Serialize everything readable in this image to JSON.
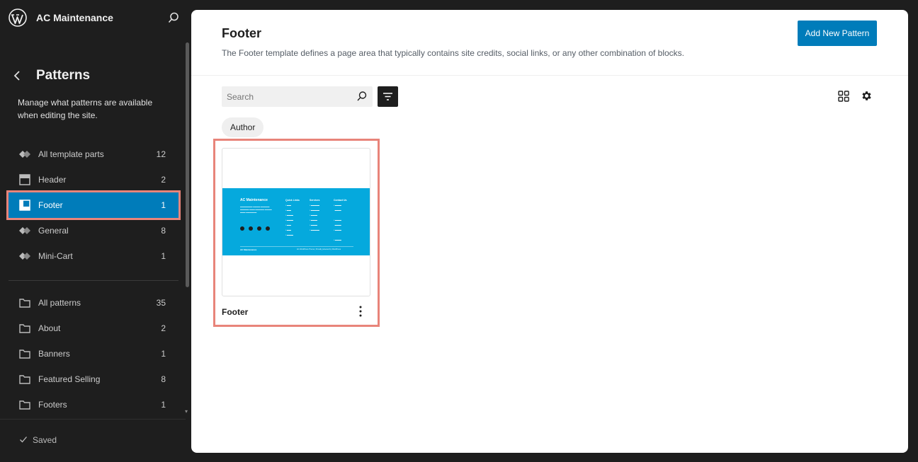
{
  "site": {
    "name": "AC Maintenance"
  },
  "sidebar": {
    "title": "Patterns",
    "description": "Manage what patterns are available when editing the site.",
    "template_parts": [
      {
        "label": "All template parts",
        "count": "12",
        "icon": "symbol-icon"
      },
      {
        "label": "Header",
        "count": "2",
        "icon": "header-icon"
      },
      {
        "label": "Footer",
        "count": "1",
        "icon": "footer-icon",
        "active": true
      },
      {
        "label": "General",
        "count": "8",
        "icon": "symbol-icon"
      },
      {
        "label": "Mini-Cart",
        "count": "1",
        "icon": "symbol-icon"
      }
    ],
    "pattern_categories": [
      {
        "label": "All patterns",
        "count": "35",
        "icon": "folder-icon"
      },
      {
        "label": "About",
        "count": "2",
        "icon": "folder-icon"
      },
      {
        "label": "Banners",
        "count": "1",
        "icon": "folder-icon"
      },
      {
        "label": "Featured Selling",
        "count": "8",
        "icon": "folder-icon"
      },
      {
        "label": "Footers",
        "count": "1",
        "icon": "folder-icon"
      }
    ],
    "status": "Saved"
  },
  "main": {
    "title": "Footer",
    "description": "The Footer template defines a page area that typically contains site credits, social links, or any other combination of blocks.",
    "add_button": "Add New Pattern",
    "search_placeholder": "Search",
    "filter_chip": "Author",
    "cards": [
      {
        "title": "Footer"
      }
    ]
  },
  "preview": {
    "brand": "AC Maintenance",
    "col1_title": "Quick Links",
    "col2_title": "Services",
    "col3_title": "Contact Us",
    "bottom_left": "AC Maintenance",
    "bottom_right": "AC WordPress Theme | Proudly powered by WordPress"
  },
  "colors": {
    "accent": "#007cba",
    "highlight": "#e8847a",
    "preview_bg": "#05a9dd",
    "sidebar_bg": "#1e1e1e"
  }
}
